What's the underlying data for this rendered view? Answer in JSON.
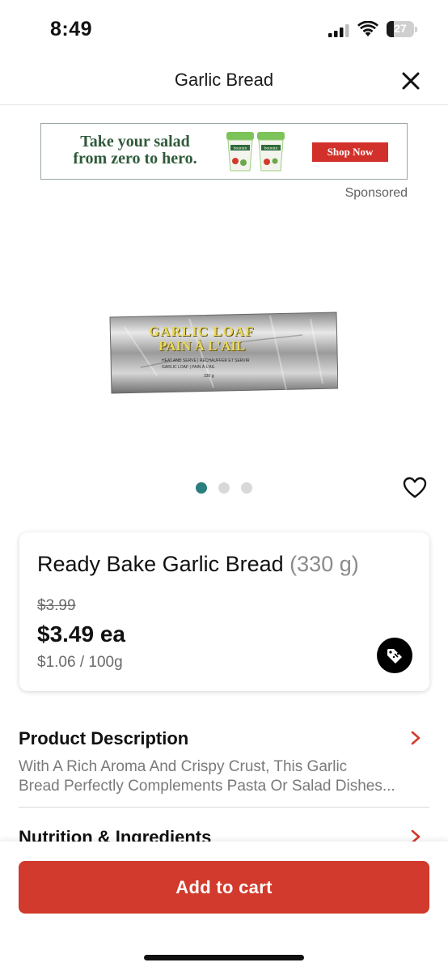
{
  "status_bar": {
    "time": "8:49",
    "battery_level": 27,
    "battery_text": "27",
    "icons": [
      "signal-icon",
      "wifi-icon",
      "battery-icon"
    ]
  },
  "header": {
    "title": "Garlic Bread",
    "close_icon": "close-icon"
  },
  "ad": {
    "headline_line1": "Take your salad",
    "headline_line2": "from zero to hero.",
    "brand": "boursin",
    "cta": "Shop Now",
    "sponsored_label": "Sponsored",
    "colors": {
      "headline": "#2f5a3a",
      "cta_bg": "#d2302a"
    }
  },
  "product_image": {
    "bag_line1": "GARLIC LOAF",
    "bag_line2": "PAIN À L'AIL",
    "bag_line3": "HEAT AND SERVE | RÉCHAUFFER ET SERVIR",
    "bag_line4": "GARLIC LOAF | PAIN À L'AIL",
    "bag_weight": "330 g"
  },
  "carousel": {
    "total": 3,
    "active_index": 0,
    "colors": {
      "active": "#2b7e7e",
      "inactive": "#d9d9d9"
    }
  },
  "favorite_icon": "heart-icon",
  "product": {
    "name": "Ready Bake Garlic Bread",
    "size": "(330 g)",
    "old_price": "$3.99",
    "price": "$3.49 ea",
    "unit_price": "$1.06 / 100g",
    "deal_icon": "price-tag-icon"
  },
  "details": {
    "description_title": "Product Description",
    "description_line1": "With A Rich Aroma And Crispy Crust, This Garlic",
    "description_line2": "Bread Perfectly Complements Pasta Or Salad Dishes...",
    "nutrition_title": "Nutrition & Ingredients"
  },
  "cart": {
    "add_label": "Add to cart",
    "color": "#d13a2c"
  }
}
